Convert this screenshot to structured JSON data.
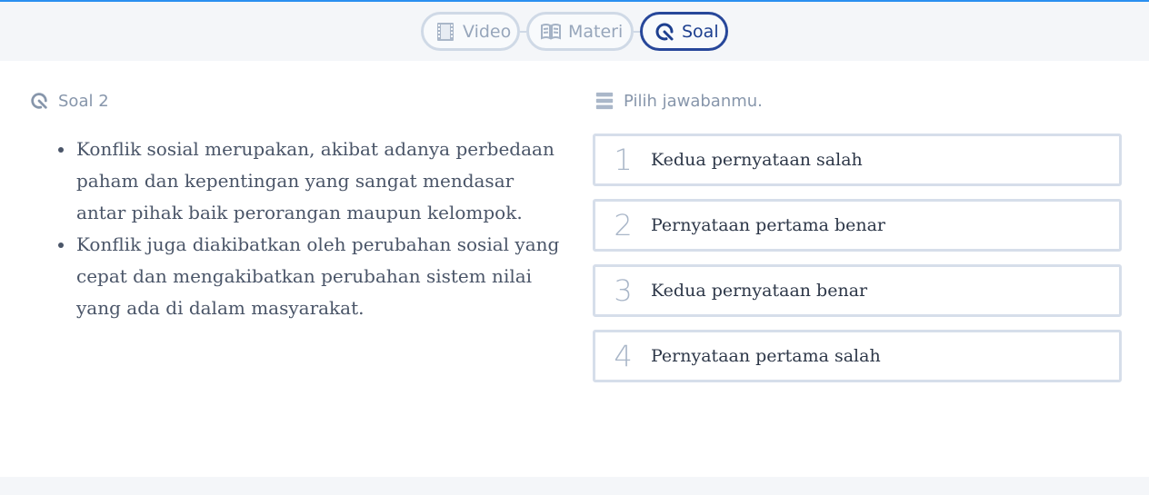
{
  "tabs": [
    {
      "label": "Video",
      "icon": "film-icon"
    },
    {
      "label": "Materi",
      "icon": "book-icon"
    },
    {
      "label": "Soal",
      "icon": "quiz-icon",
      "active": true
    }
  ],
  "question": {
    "title": "Soal 2",
    "bullets": [
      "Konflik sosial merupakan, akibat adanya perbedaan paham dan kepentingan yang sangat mendasar antar pihak baik perorangan maupun kelompok.",
      "Konflik juga diakibatkan oleh perubahan sosial yang cepat dan mengakibatkan perubahan sistem nilai yang ada di dalam masyarakat."
    ]
  },
  "answers": {
    "title": "Pilih jawabanmu.",
    "options": [
      {
        "number": "1",
        "text": "Kedua pernyataan salah"
      },
      {
        "number": "2",
        "text": "Pernyataan pertama benar"
      },
      {
        "number": "3",
        "text": "Kedua pernyataan benar"
      },
      {
        "number": "4",
        "text": "Pernyataan pertama salah"
      }
    ]
  },
  "colors": {
    "accent": "#27479a",
    "top_line": "#2a8ff0",
    "tab_border": "#cfd9e6",
    "muted_text": "#8796ab"
  }
}
